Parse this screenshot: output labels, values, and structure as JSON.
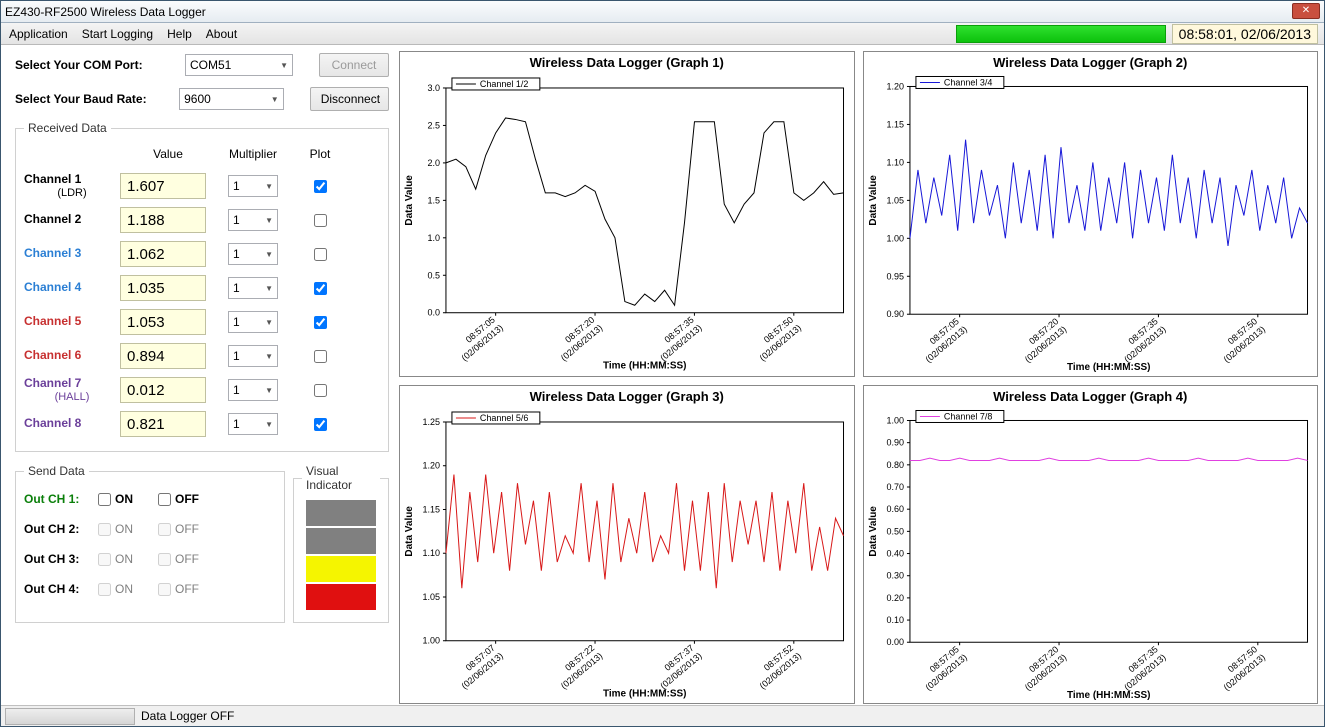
{
  "window_title": "EZ430-RF2500 Wireless Data Logger",
  "menu": [
    "Application",
    "Start Logging",
    "Help",
    "About"
  ],
  "timestamp": "08:58:01, 02/06/2013",
  "labels": {
    "com_port": "Select Your COM Port:",
    "baud_rate": "Select Your Baud Rate:",
    "connect": "Connect",
    "disconnect": "Disconnect",
    "received": "Received Data",
    "value": "Value",
    "multiplier": "Multiplier",
    "plot": "Plot",
    "send": "Send Data",
    "on": "ON",
    "off": "OFF",
    "visual": "Visual Indicator",
    "logger_off": "Data Logger OFF"
  },
  "com_port": "COM51",
  "baud_rate": "9600",
  "channels": [
    {
      "name": "Channel 1",
      "sub": "(LDR)",
      "color": "#000",
      "value": "1.607",
      "mult": "1",
      "plot": true
    },
    {
      "name": "Channel 2",
      "sub": "",
      "color": "#000",
      "value": "1.188",
      "mult": "1",
      "plot": false
    },
    {
      "name": "Channel 3",
      "sub": "",
      "color": "#2b7fd4",
      "value": "1.062",
      "mult": "1",
      "plot": false
    },
    {
      "name": "Channel 4",
      "sub": "",
      "color": "#2b7fd4",
      "value": "1.035",
      "mult": "1",
      "plot": true
    },
    {
      "name": "Channel 5",
      "sub": "",
      "color": "#c73030",
      "value": "1.053",
      "mult": "1",
      "plot": true
    },
    {
      "name": "Channel 6",
      "sub": "",
      "color": "#c73030",
      "value": "0.894",
      "mult": "1",
      "plot": false
    },
    {
      "name": "Channel 7",
      "sub": "(HALL)",
      "color": "#6b3f9a",
      "value": "0.012",
      "mult": "1",
      "plot": false
    },
    {
      "name": "Channel 8",
      "sub": "",
      "color": "#6b3f9a",
      "value": "0.821",
      "mult": "1",
      "plot": true
    }
  ],
  "out_channels": [
    {
      "label": "Out CH 1:",
      "color": "#0a7f0a",
      "enabled": true
    },
    {
      "label": "Out CH 2:",
      "color": "#000",
      "enabled": false
    },
    {
      "label": "Out CH 3:",
      "color": "#000",
      "enabled": false
    },
    {
      "label": "Out CH 4:",
      "color": "#000",
      "enabled": false
    }
  ],
  "visual_indicators": [
    "#808080",
    "#808080",
    "#f5f500",
    "#e01010"
  ],
  "charts": {
    "1": {
      "title": "Wireless Data Logger (Graph 1)",
      "legend": "Channel 1/2",
      "color": "#000",
      "xlabel": "Time (HH:MM:SS)",
      "ylabel": "Data Value"
    },
    "2": {
      "title": "Wireless Data Logger (Graph 2)",
      "legend": "Channel 3/4",
      "color": "#1818d8",
      "xlabel": "Time (HH:MM:SS)",
      "ylabel": "Data Value"
    },
    "3": {
      "title": "Wireless Data Logger (Graph 3)",
      "legend": "Channel 5/6",
      "color": "#d81818",
      "xlabel": "Time (HH:MM:SS)",
      "ylabel": "Data Value"
    },
    "4": {
      "title": "Wireless Data Logger (Graph 4)",
      "legend": "Channel 7/8",
      "color": "#e040e0",
      "xlabel": "Time (HH:MM:SS)",
      "ylabel": "Data Value"
    }
  },
  "chart_data": [
    {
      "id": 1,
      "type": "line",
      "title": "Wireless Data Logger (Graph 1)",
      "legend": "Channel 1/2",
      "xlabel": "Time (HH:MM:SS)",
      "ylabel": "Data Value",
      "ylim": [
        0.0,
        3.0
      ],
      "yticks": [
        0.0,
        0.5,
        1.0,
        1.5,
        2.0,
        2.5,
        3.0
      ],
      "xticks": [
        "08:57:05 (02/06/2013)",
        "08:57:20 (02/06/2013)",
        "08:57:35 (02/06/2013)",
        "08:57:50 (02/06/2013)"
      ],
      "values": [
        2.0,
        2.05,
        1.95,
        1.65,
        2.1,
        2.4,
        2.6,
        2.58,
        2.55,
        2.05,
        1.6,
        1.6,
        1.55,
        1.6,
        1.7,
        1.62,
        1.25,
        1.0,
        0.15,
        0.1,
        0.25,
        0.15,
        0.3,
        0.1,
        1.2,
        2.55,
        2.55,
        2.55,
        1.45,
        1.2,
        1.45,
        1.6,
        2.4,
        2.55,
        2.55,
        1.6,
        1.5,
        1.6,
        1.75,
        1.58,
        1.6
      ]
    },
    {
      "id": 2,
      "type": "line",
      "title": "Wireless Data Logger (Graph 2)",
      "legend": "Channel 3/4",
      "xlabel": "Time (HH:MM:SS)",
      "ylabel": "Data Value",
      "ylim": [
        0.9,
        1.2
      ],
      "yticks": [
        0.9,
        0.95,
        1.0,
        1.05,
        1.1,
        1.15,
        1.2
      ],
      "xticks": [
        "08:57:05 (02/06/2013)",
        "08:57:20 (02/06/2013)",
        "08:57:35 (02/06/2013)",
        "08:57:50 (02/06/2013)"
      ],
      "values": [
        1.0,
        1.09,
        1.02,
        1.08,
        1.03,
        1.11,
        1.01,
        1.13,
        1.02,
        1.09,
        1.03,
        1.07,
        1.0,
        1.1,
        1.02,
        1.09,
        1.01,
        1.11,
        1.0,
        1.12,
        1.02,
        1.07,
        1.01,
        1.1,
        1.01,
        1.08,
        1.02,
        1.1,
        1.0,
        1.09,
        1.02,
        1.08,
        1.01,
        1.11,
        1.02,
        1.08,
        1.0,
        1.09,
        1.02,
        1.08,
        0.99,
        1.07,
        1.03,
        1.09,
        1.01,
        1.07,
        1.02,
        1.08,
        1.0,
        1.04,
        1.02
      ]
    },
    {
      "id": 3,
      "type": "line",
      "title": "Wireless Data Logger (Graph 3)",
      "legend": "Channel 5/6",
      "xlabel": "Time (HH:MM:SS)",
      "ylabel": "Data Value",
      "ylim": [
        1.0,
        1.25
      ],
      "yticks": [
        1.0,
        1.05,
        1.1,
        1.15,
        1.2,
        1.25
      ],
      "xticks": [
        "08:57:07 (02/06/2013)",
        "08:57:22 (02/06/2013)",
        "08:57:37 (02/06/2013)",
        "08:57:52 (02/06/2013)"
      ],
      "values": [
        1.1,
        1.19,
        1.06,
        1.17,
        1.09,
        1.19,
        1.1,
        1.17,
        1.08,
        1.18,
        1.11,
        1.16,
        1.08,
        1.17,
        1.09,
        1.12,
        1.1,
        1.18,
        1.09,
        1.16,
        1.07,
        1.18,
        1.09,
        1.14,
        1.1,
        1.17,
        1.09,
        1.12,
        1.1,
        1.18,
        1.08,
        1.16,
        1.08,
        1.17,
        1.06,
        1.18,
        1.09,
        1.16,
        1.11,
        1.16,
        1.09,
        1.17,
        1.08,
        1.16,
        1.1,
        1.18,
        1.08,
        1.13,
        1.08,
        1.14,
        1.12
      ]
    },
    {
      "id": 4,
      "type": "line",
      "title": "Wireless Data Logger (Graph 4)",
      "legend": "Channel 7/8",
      "xlabel": "Time (HH:MM:SS)",
      "ylabel": "Data Value",
      "ylim": [
        0.0,
        1.0
      ],
      "yticks": [
        0.0,
        0.1,
        0.2,
        0.3,
        0.4,
        0.5,
        0.6,
        0.7,
        0.8,
        0.9,
        1.0
      ],
      "xticks": [
        "08:57:05 (02/06/2013)",
        "08:57:20 (02/06/2013)",
        "08:57:35 (02/06/2013)",
        "08:57:50 (02/06/2013)"
      ],
      "values": [
        0.82,
        0.82,
        0.83,
        0.82,
        0.82,
        0.83,
        0.82,
        0.82,
        0.82,
        0.83,
        0.82,
        0.82,
        0.82,
        0.82,
        0.83,
        0.82,
        0.82,
        0.82,
        0.82,
        0.83,
        0.82,
        0.82,
        0.82,
        0.82,
        0.83,
        0.82,
        0.82,
        0.82,
        0.82,
        0.83,
        0.82,
        0.82,
        0.82,
        0.82,
        0.83,
        0.82,
        0.82,
        0.82,
        0.82,
        0.83,
        0.82
      ]
    }
  ]
}
